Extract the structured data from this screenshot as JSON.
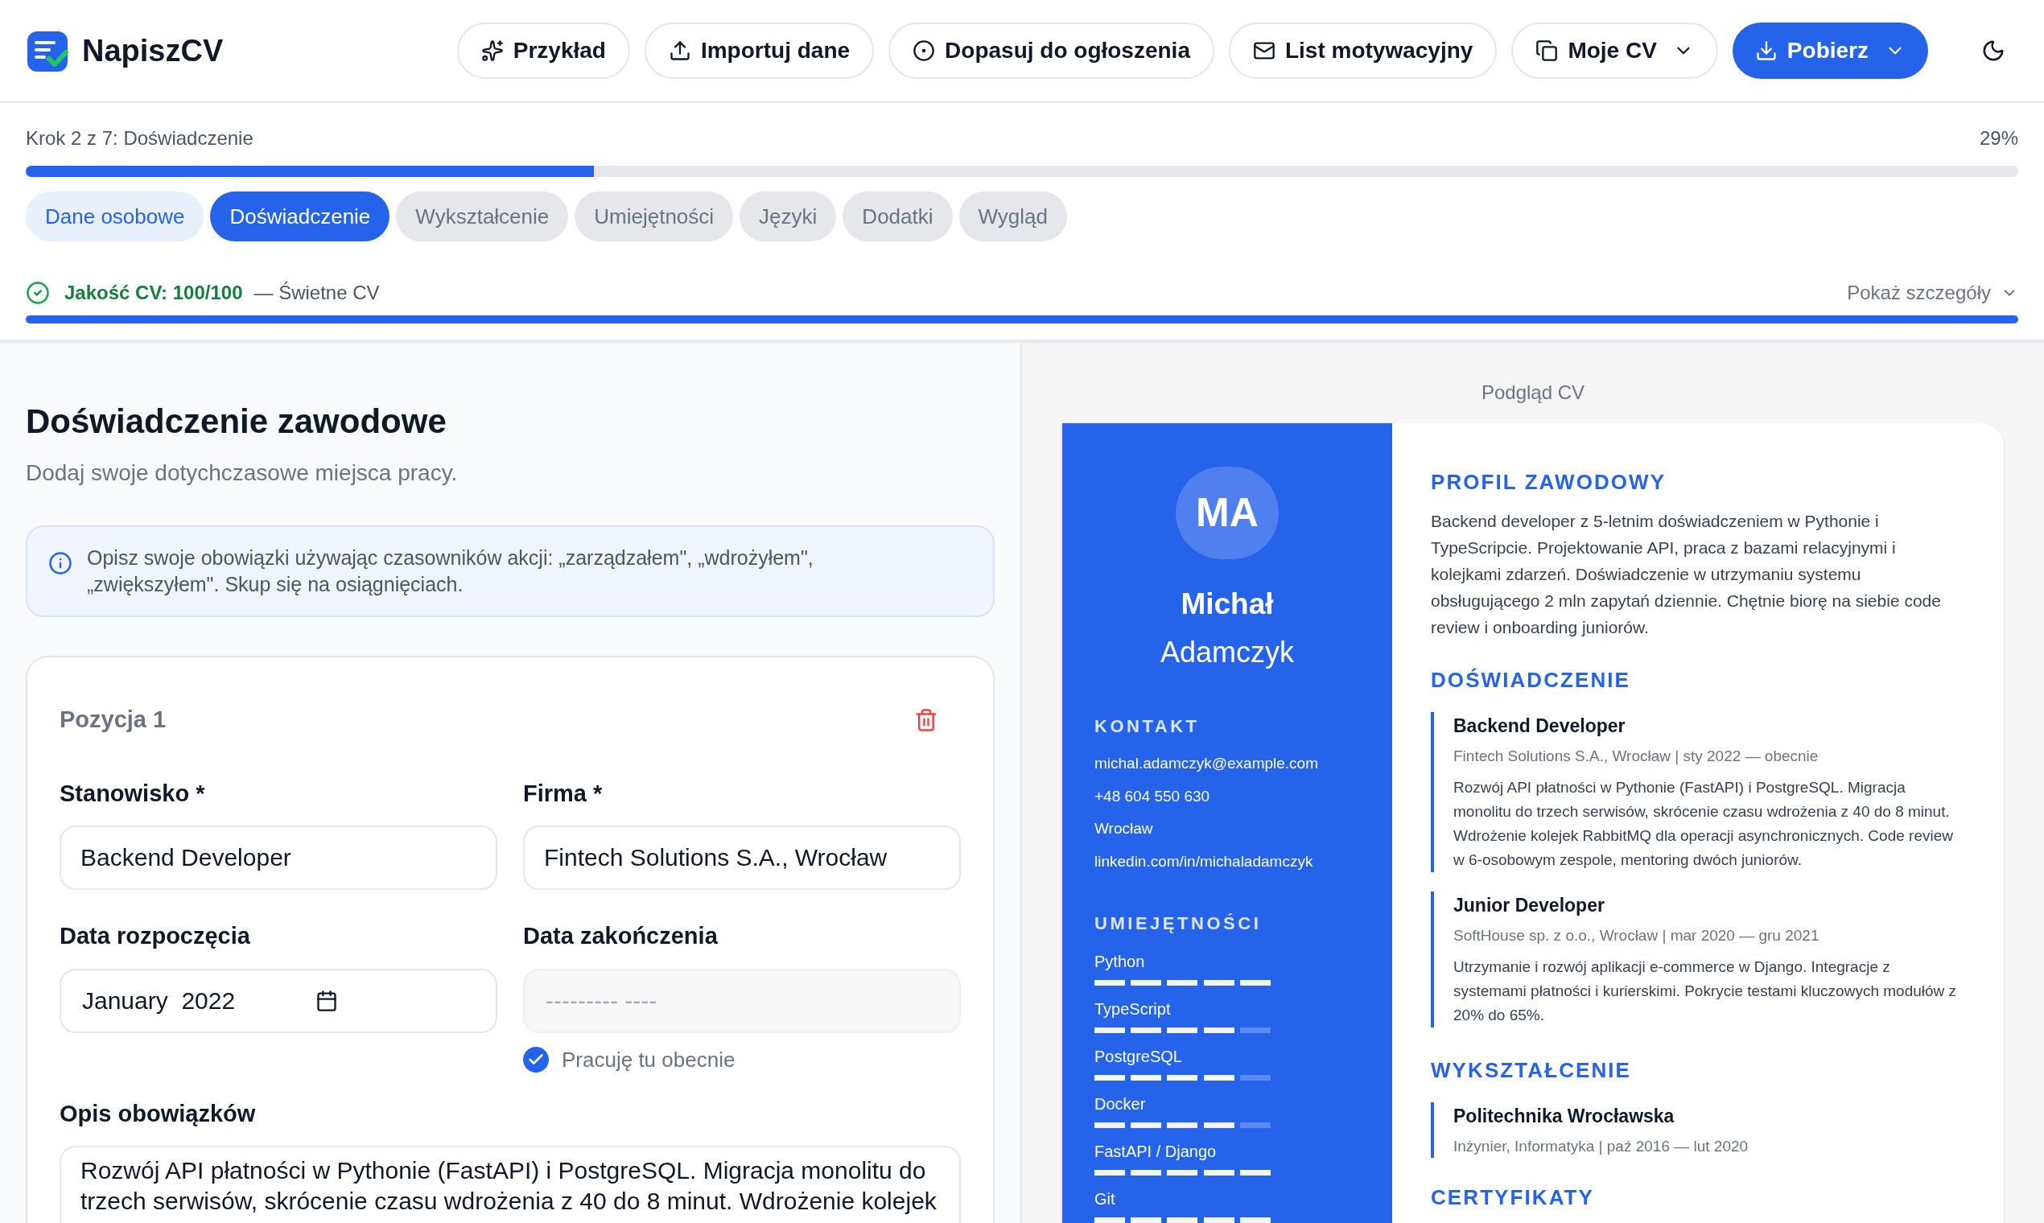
{
  "header": {
    "brand": "NapiszCV",
    "actions": [
      {
        "label": "Przykład",
        "kind": "outline",
        "dropdown": false
      },
      {
        "label": "Importuj dane",
        "kind": "outline",
        "dropdown": false
      },
      {
        "label": "Dopasuj do ogłoszenia",
        "kind": "outline",
        "dropdown": false
      },
      {
        "label": "List motywacyjny",
        "kind": "outline",
        "dropdown": false
      },
      {
        "label": "Moje CV",
        "kind": "outline",
        "dropdown": true
      },
      {
        "label": "Pobierz",
        "kind": "primary",
        "dropdown": true
      }
    ]
  },
  "progress": {
    "step_label": "Krok 2 z 7: Doświadczenie",
    "percent": "29%",
    "level": 0.285
  },
  "steps": [
    {
      "label": "Dane osobowe",
      "selected": false,
      "completed": true
    },
    {
      "label": "Doświadczenie",
      "selected": true,
      "completed": false
    },
    {
      "label": "Wykształcenie",
      "selected": false,
      "completed": false
    },
    {
      "label": "Umiejętności",
      "selected": false,
      "completed": false
    },
    {
      "label": "Języki",
      "selected": false,
      "completed": false
    },
    {
      "label": "Dodatki",
      "selected": false,
      "completed": false
    },
    {
      "label": "Wygląd",
      "selected": false,
      "completed": false
    }
  ],
  "quality": {
    "score": "Jakość CV: 100/100",
    "verdict": "— Świetne CV",
    "details_link": "Pokaż szczegóły",
    "level": 1
  },
  "form": {
    "title": "Doświadczenie zawodowe",
    "subtitle": "Dodaj swoje dotychczasowe miejsca pracy.",
    "tip": "Opisz swoje obowiązki używając czasowników akcji: „zarządzałem\", „wdrożyłem\", „zwiększyłem\". Skup się na osiągnięciach.",
    "position": {
      "title": "Pozycja 1",
      "job_title": {
        "label": "Stanowisko *",
        "value": "Backend Developer"
      },
      "company": {
        "label": "Firma *",
        "value": "Fintech Solutions S.A., Wrocław"
      },
      "start_date": {
        "label": "Data rozpoczęcia",
        "value": "January  2022"
      },
      "end_date": {
        "label": "Data zakończenia",
        "placeholder": "--------- ----",
        "disabled": true
      },
      "current_job": {
        "label": "Pracuję tu obecnie",
        "checked": true
      },
      "description": {
        "label": "Opis obowiązków",
        "value": "Rozwój API płatności w Pythonie (FastAPI) i PostgreSQL. Migracja monolitu do trzech serwisów, skrócenie czasu wdrożenia z 40 do 8 minut. Wdrożenie kolejek"
      }
    }
  },
  "preview": {
    "label": "Podgląd CV",
    "cv": {
      "initials": "MA",
      "first_name": "Michał",
      "last_name": "Adamczyk",
      "contact_heading": "KONTAKT",
      "contacts": [
        "michal.adamczyk@example.com",
        "+48 604 550 630",
        "Wrocław",
        "linkedin.com/in/michaladamczyk"
      ],
      "skills_heading": "UMIEJĘTNOŚCI",
      "skills": [
        {
          "name": "Python",
          "level": 1
        },
        {
          "name": "TypeScript",
          "level": 0.8
        },
        {
          "name": "PostgreSQL",
          "level": 0.8
        },
        {
          "name": "Docker",
          "level": 0.8
        },
        {
          "name": "FastAPI / Django",
          "level": 1
        },
        {
          "name": "Git",
          "level": 1
        }
      ],
      "profile_heading": "PROFIL ZAWODOWY",
      "profile": "Backend developer z 5-letnim doświadczeniem w Pythonie i TypeScripcie. Projektowanie API, praca z bazami relacyjnymi i kolejkami zdarzeń. Doświadczenie w utrzymaniu systemu obsługującego 2 mln zapytań dziennie. Chętnie biorę na siebie code review i onboarding juniorów.",
      "experience_heading": "DOŚWIADCZENIE",
      "experience": [
        {
          "title": "Backend Developer",
          "meta": "Fintech Solutions S.A., Wrocław | sty 2022 — obecnie",
          "description": "Rozwój API płatności w Pythonie (FastAPI) i PostgreSQL. Migracja monolitu do trzech serwisów, skrócenie czasu wdrożenia z 40 do 8 minut. Wdrożenie kolejek RabbitMQ dla operacji asynchronicznych. Code review w 6-osobowym zespole, mentoring dwóch juniorów."
        },
        {
          "title": "Junior Developer",
          "meta": "SoftHouse sp. z o.o., Wrocław | mar 2020 — gru 2021",
          "description": "Utrzymanie i rozwój aplikacji e-commerce w Django. Integracje z systemami płatności i kurierskimi. Pokrycie testami kluczowych modułów z 20% do 65%."
        }
      ],
      "education_heading": "WYKSZTAŁCENIE",
      "education": [
        {
          "title": "Politechnika Wrocławska",
          "meta": "Inżynier, Informatyka | paź 2016 — lut 2020"
        }
      ],
      "certificates_heading": "CERTYFIKATY"
    }
  }
}
